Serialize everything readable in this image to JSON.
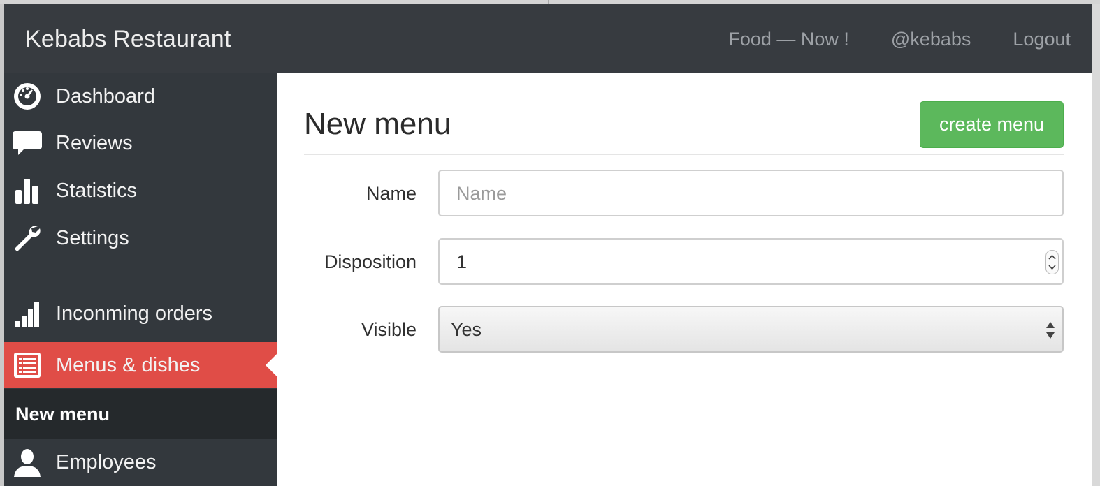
{
  "navbar": {
    "brand": "Kebabs Restaurant",
    "links": [
      "Food — Now !",
      "@kebabs",
      "Logout"
    ]
  },
  "sidebar": {
    "items": [
      {
        "label": "Dashboard",
        "icon": "dashboard-icon"
      },
      {
        "label": "Reviews",
        "icon": "speech-bubble-icon"
      },
      {
        "label": "Statistics",
        "icon": "bar-chart-icon"
      },
      {
        "label": "Settings",
        "icon": "wrench-icon"
      },
      {
        "label": "Inconming orders",
        "icon": "signal-bars-icon"
      },
      {
        "label": "Menus & dishes",
        "icon": "list-icon",
        "active": true
      },
      {
        "label": "Employees",
        "icon": "user-icon"
      }
    ],
    "sub_item": "New menu"
  },
  "main": {
    "title": "New menu",
    "create_button": "create menu",
    "form": {
      "name_label": "Name",
      "name_placeholder": "Name",
      "disposition_label": "Disposition",
      "disposition_value": "1",
      "visible_label": "Visible",
      "visible_value": "Yes"
    }
  },
  "colors": {
    "navbar_bg": "#373b40",
    "sidebar_bg": "#33383d",
    "active_bg": "#e04d47",
    "sub_bg": "#25292c",
    "button_green": "#5cb85c"
  }
}
